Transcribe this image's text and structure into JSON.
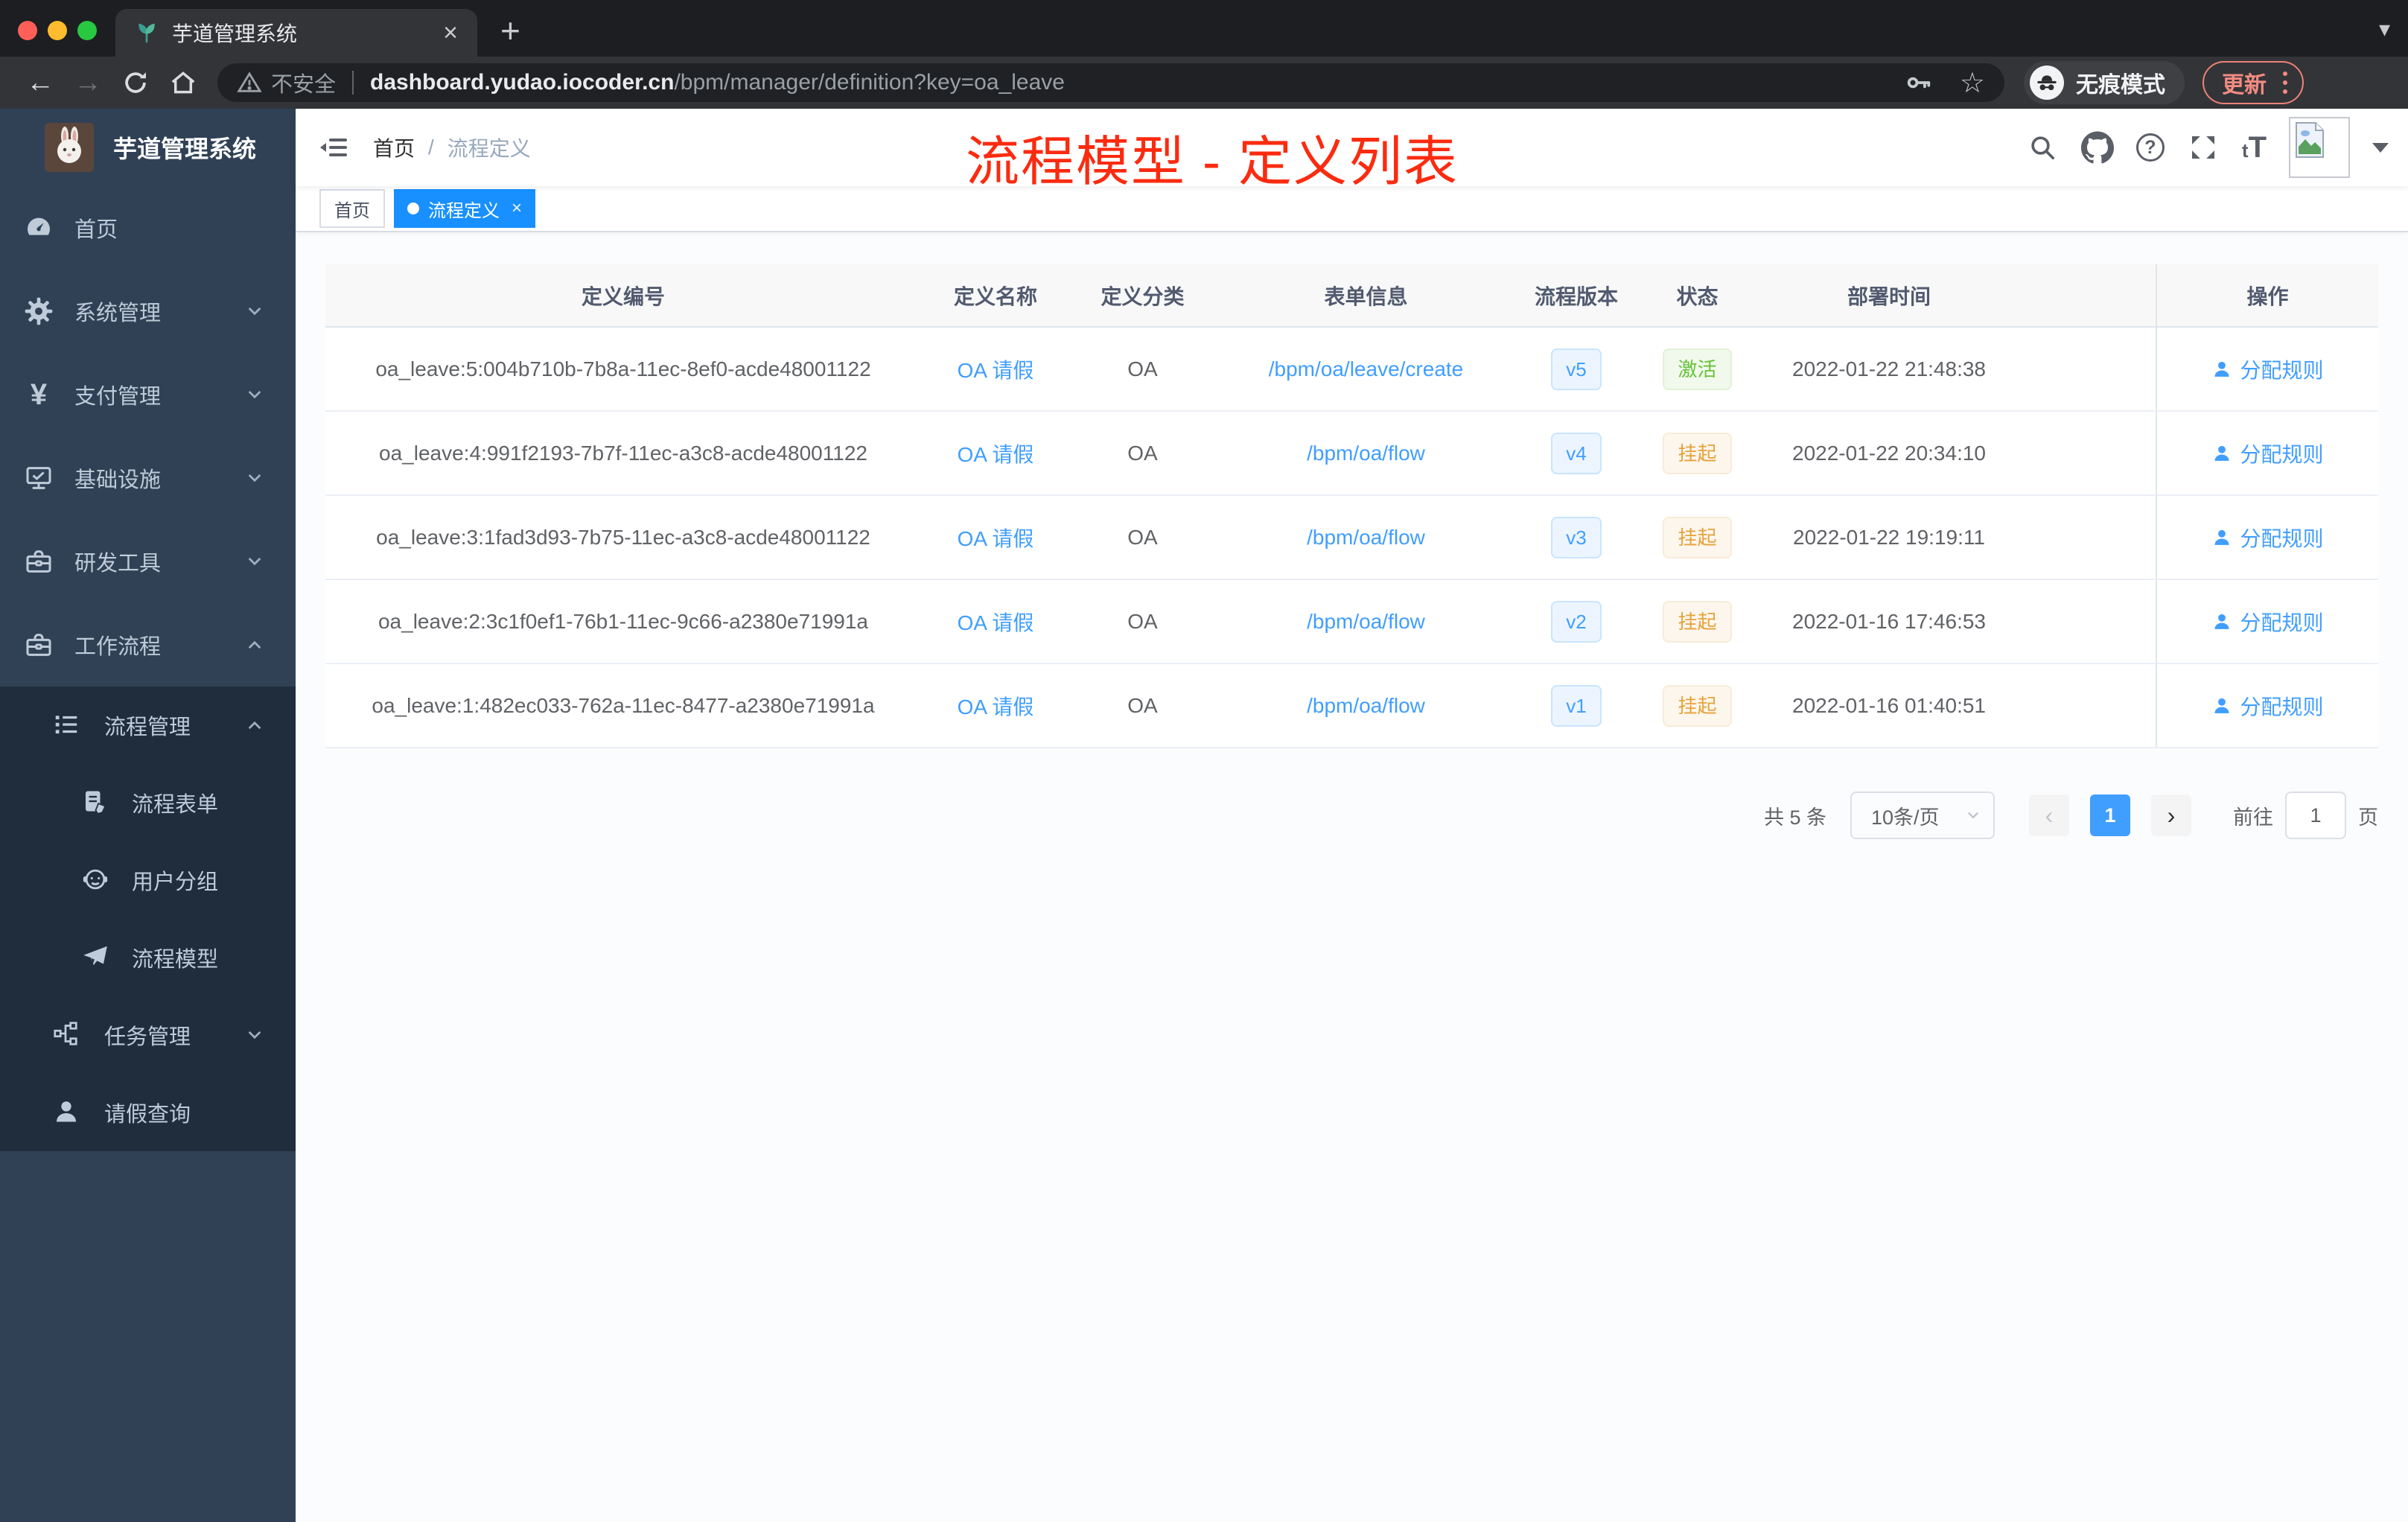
{
  "browser": {
    "tab_title": "芋道管理系统",
    "security_label": "不安全",
    "url_host": "dashboard.yudao.iocoder.cn",
    "url_path": "/bpm/manager/definition?key=oa_leave",
    "incognito_label": "无痕模式",
    "update_label": "更新"
  },
  "sidebar": {
    "title": "芋道管理系统",
    "menu": [
      {
        "label": "首页",
        "icon": "dashboard-icon"
      },
      {
        "label": "系统管理",
        "icon": "gear-icon"
      },
      {
        "label": "支付管理",
        "icon": "yen-icon"
      },
      {
        "label": "基础设施",
        "icon": "monitor-icon"
      },
      {
        "label": "研发工具",
        "icon": "toolbox-icon"
      },
      {
        "label": "工作流程",
        "icon": "briefcase-icon"
      },
      {
        "label": "流程管理",
        "icon": "list-icon"
      },
      {
        "label": "流程表单",
        "icon": "form-icon"
      },
      {
        "label": "用户分组",
        "icon": "robot-icon"
      },
      {
        "label": "流程模型",
        "icon": "paper-plane-icon"
      },
      {
        "label": "任务管理",
        "icon": "tree-icon"
      },
      {
        "label": "请假查询",
        "icon": "user-icon"
      }
    ],
    "yen_glyph": "¥"
  },
  "navbar": {
    "breadcrumb_home": "首页",
    "breadcrumb_sep": "/",
    "breadcrumb_current": "流程定义",
    "annotation": "流程模型 - 定义列表",
    "annotation_color": "#fb2b10"
  },
  "tags": {
    "home": "首页",
    "active": "流程定义",
    "active_color": "#1890ff"
  },
  "table": {
    "columns": [
      "定义编号",
      "定义名称",
      "定义分类",
      "表单信息",
      "流程版本",
      "状态",
      "部署时间",
      "操作"
    ],
    "rows": [
      {
        "id": "oa_leave:5:004b710b-7b8a-11ec-8ef0-acde48001122",
        "name": "OA 请假",
        "category": "OA",
        "form": "/bpm/oa/leave/create",
        "version": "v5",
        "status": "激活",
        "status_type": "success",
        "time": "2022-01-22 21:48:38",
        "action": "分配规则"
      },
      {
        "id": "oa_leave:4:991f2193-7b7f-11ec-a3c8-acde48001122",
        "name": "OA 请假",
        "category": "OA",
        "form": "/bpm/oa/flow",
        "version": "v4",
        "status": "挂起",
        "status_type": "warning",
        "time": "2022-01-22 20:34:10",
        "action": "分配规则"
      },
      {
        "id": "oa_leave:3:1fad3d93-7b75-11ec-a3c8-acde48001122",
        "name": "OA 请假",
        "category": "OA",
        "form": "/bpm/oa/flow",
        "version": "v3",
        "status": "挂起",
        "status_type": "warning",
        "time": "2022-01-22 19:19:11",
        "action": "分配规则"
      },
      {
        "id": "oa_leave:2:3c1f0ef1-76b1-11ec-9c66-a2380e71991a",
        "name": "OA 请假",
        "category": "OA",
        "form": "/bpm/oa/flow",
        "version": "v2",
        "status": "挂起",
        "status_type": "warning",
        "time": "2022-01-16 17:46:53",
        "action": "分配规则"
      },
      {
        "id": "oa_leave:1:482ec033-762a-11ec-8477-a2380e71991a",
        "name": "OA 请假",
        "category": "OA",
        "form": "/bpm/oa/flow",
        "version": "v1",
        "status": "挂起",
        "status_type": "warning",
        "time": "2022-01-16 01:40:51",
        "action": "分配规则"
      }
    ],
    "status_colors": {
      "success": "#67c23a",
      "warning": "#e6a23c",
      "link": "#409eff"
    }
  },
  "pagination": {
    "total": "共 5 条",
    "page_size": "10条/页",
    "prev": "‹",
    "current_page": "1",
    "next": "›",
    "goto_label": "前往",
    "goto_value": "1",
    "unit": "页"
  }
}
